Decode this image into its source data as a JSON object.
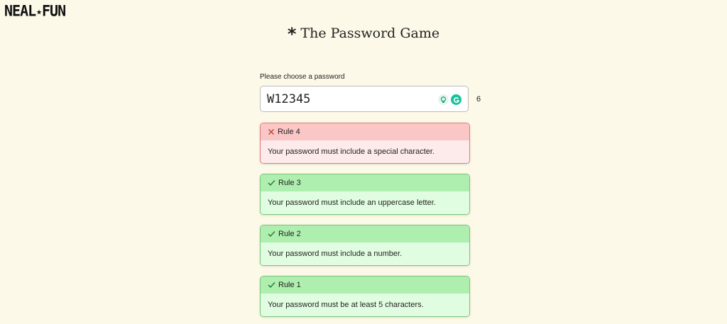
{
  "site": {
    "logo_left": "NEAL",
    "logo_star": "★",
    "logo_right": "FUN"
  },
  "page": {
    "title": "The Password Game",
    "title_mark": "*"
  },
  "password": {
    "label": "Please choose a password",
    "value": "W12345",
    "char_count": "6"
  },
  "extensions": [
    "lightbulb-icon",
    "grammarly-icon"
  ],
  "colors": {
    "background": "#fdf9e8",
    "fail_header": "#fbc6c6",
    "fail_body": "#fdebeb",
    "fail_border": "#e07a7a",
    "pass_header": "#aeeeae",
    "pass_body": "#e1fde1",
    "pass_border": "#7bc47b"
  },
  "rules": [
    {
      "status": "fail",
      "title": "Rule 4",
      "text": "Your password must include a special character."
    },
    {
      "status": "pass",
      "title": "Rule 3",
      "text": "Your password must include an uppercase letter."
    },
    {
      "status": "pass",
      "title": "Rule 2",
      "text": "Your password must include a number."
    },
    {
      "status": "pass",
      "title": "Rule 1",
      "text": "Your password must be at least 5 characters."
    }
  ]
}
